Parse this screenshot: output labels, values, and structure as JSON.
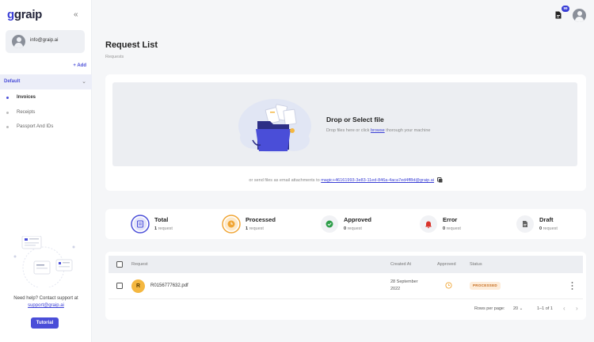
{
  "app": {
    "logo_text": "graip",
    "logo_g": "g"
  },
  "sidebar": {
    "user_email": "info@graip.ai",
    "add_label": "+ Add",
    "group_label": "Default",
    "items": [
      {
        "label": "Invoices",
        "active": true
      },
      {
        "label": "Receipts",
        "active": false
      },
      {
        "label": "Passport And IDs",
        "active": false
      }
    ],
    "help_text": "Need help? Contact support at",
    "support_email": "support@graip.ai",
    "tutorial_label": "Tutorial"
  },
  "header": {
    "notification_count": "99"
  },
  "page": {
    "title": "Request List",
    "breadcrumb": "Requests"
  },
  "upload": {
    "title": "Drop or Select file",
    "sub_before": "Drop files here or click ",
    "sub_link": "browse",
    "sub_after": " thorough your machine",
    "email_prefix": "or send files as email attachments to ",
    "email_address": "magic+46161993-3e83-11ed-846a-4aca7ed4ff8d@graip.ai"
  },
  "stats": [
    {
      "title": "Total",
      "count": "1",
      "unit": "request",
      "color": "#4a4ed8"
    },
    {
      "title": "Processed",
      "count": "1",
      "unit": "request",
      "color": "#f0a534"
    },
    {
      "title": "Approved",
      "count": "0",
      "unit": "request",
      "color": "#2e9e4a"
    },
    {
      "title": "Error",
      "count": "0",
      "unit": "request",
      "color": "#d9342b"
    },
    {
      "title": "Draft",
      "count": "0",
      "unit": "request",
      "color": "#666666"
    }
  ],
  "table": {
    "columns": {
      "request": "Request",
      "created_at": "Created At",
      "approved": "Approved",
      "status": "Status"
    },
    "rows": [
      {
        "avatar": "R",
        "file": "R0156777632.pdf",
        "created_line1": "28 September",
        "created_line2": "2022",
        "status": "PROCESSED"
      }
    ],
    "rows_per_page_label": "Rows per page:",
    "rows_per_page": "20",
    "range": "1–1 of 1"
  }
}
